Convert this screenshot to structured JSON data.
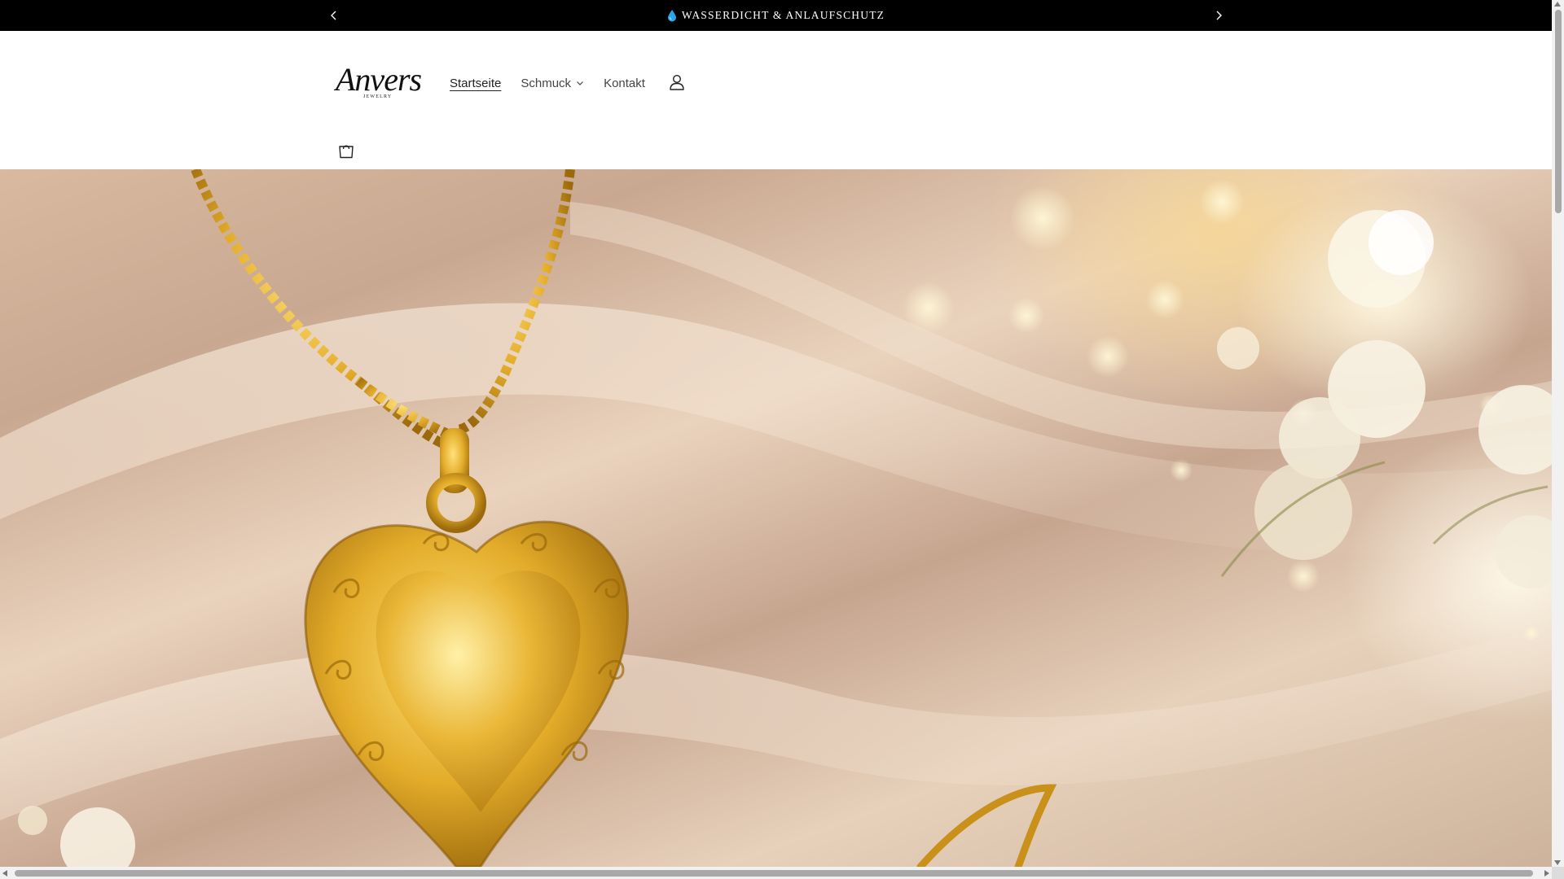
{
  "announcement": {
    "icon": "water-drop-icon",
    "text": "WASSERDICHT & ANLAUFSCHUTZ"
  },
  "brand": {
    "logo_text": "Anvers",
    "logo_subtext": "JEWELRY"
  },
  "nav": {
    "items": [
      {
        "label": "Startseite",
        "active": true
      },
      {
        "label": "Schmuck",
        "has_dropdown": true
      },
      {
        "label": "Kontakt"
      }
    ]
  },
  "header_icons": [
    "account-icon",
    "cart-icon"
  ],
  "hero": {
    "image_alt": "gold-heart-locket-necklace-on-satin"
  },
  "colors": {
    "announcement_bg": "#000000",
    "announcement_text": "#ffffff",
    "accent_gold": "#d9a521",
    "drop_blue": "#2aa7e8"
  }
}
